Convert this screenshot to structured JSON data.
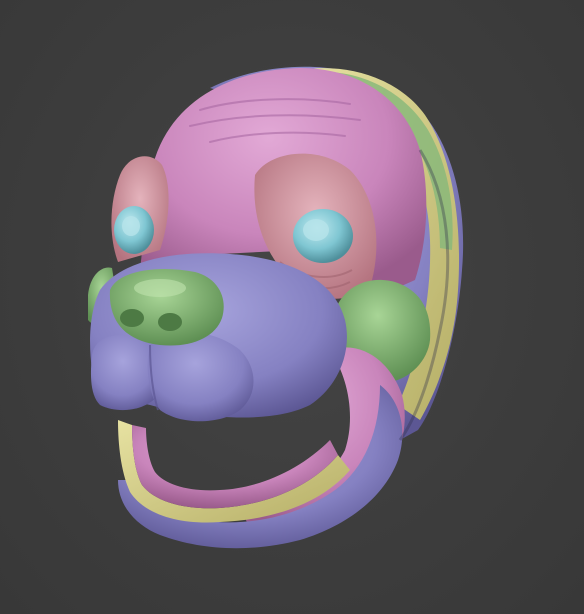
{
  "viewport": {
    "background": "#3c3c3c"
  },
  "model": {
    "subject": "mask-head-sculpt",
    "palette": {
      "pink": "#d28ec4",
      "pink_dark": "#9c5a8e",
      "salmon": "#d69aa6",
      "lavender": "#8a86c6",
      "lavender_dark": "#5f5a98",
      "green": "#8cc07a",
      "green_dark": "#5e8f52",
      "yellow": "#d9d48c",
      "eye_blue": "#7fc6d2"
    }
  }
}
